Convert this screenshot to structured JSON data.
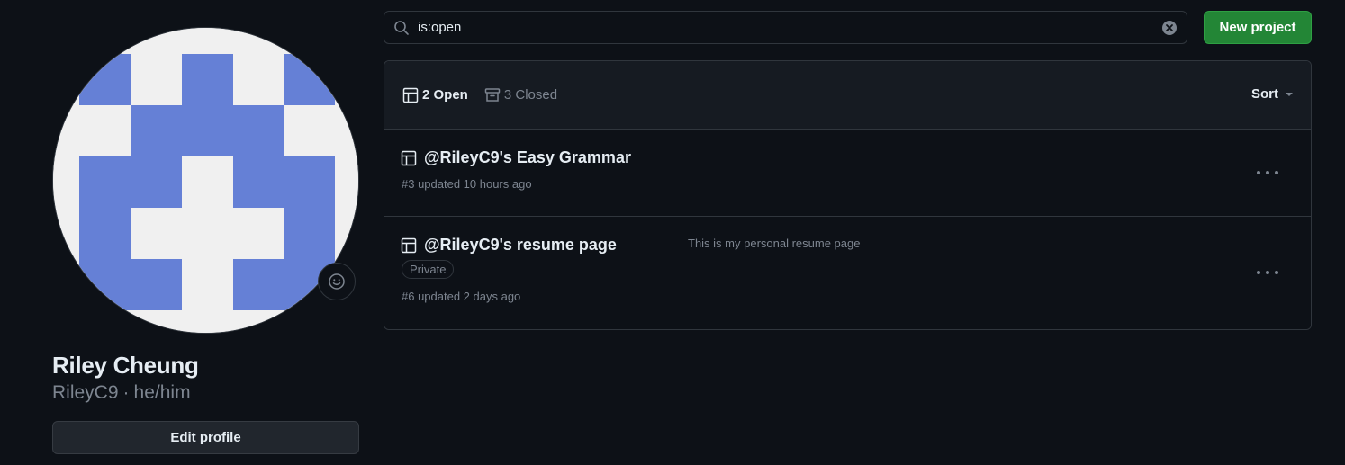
{
  "profile": {
    "name": "Riley Cheung",
    "username": "RileyC9",
    "separator": "·",
    "pronouns": "he/him",
    "edit_label": "Edit profile",
    "avatar_colors": {
      "fill": "#6580d6",
      "background": "#f0f0f0"
    },
    "status_icon": "smiley-icon"
  },
  "search": {
    "value": "is:open",
    "icon": "search-icon",
    "clear_icon": "clear-icon"
  },
  "actions": {
    "new_project_label": "New project"
  },
  "colors": {
    "accent_green": "#238636",
    "bg": "#0d1117",
    "border": "#30363d",
    "muted": "#7d8590"
  },
  "tabs": {
    "open_label": "2 Open",
    "closed_label": "3 Closed",
    "open_icon": "table-icon",
    "closed_icon": "archive-icon"
  },
  "sort": {
    "label": "Sort"
  },
  "projects": [
    {
      "title": "@RileyC9's Easy Grammar",
      "meta": "#3 updated 10 hours ago",
      "icon": "table-icon"
    },
    {
      "title": "@RileyC9's resume page",
      "badge": "Private",
      "description": "This is my personal resume page",
      "meta": "#6 updated 2 days ago",
      "icon": "table-icon"
    }
  ]
}
